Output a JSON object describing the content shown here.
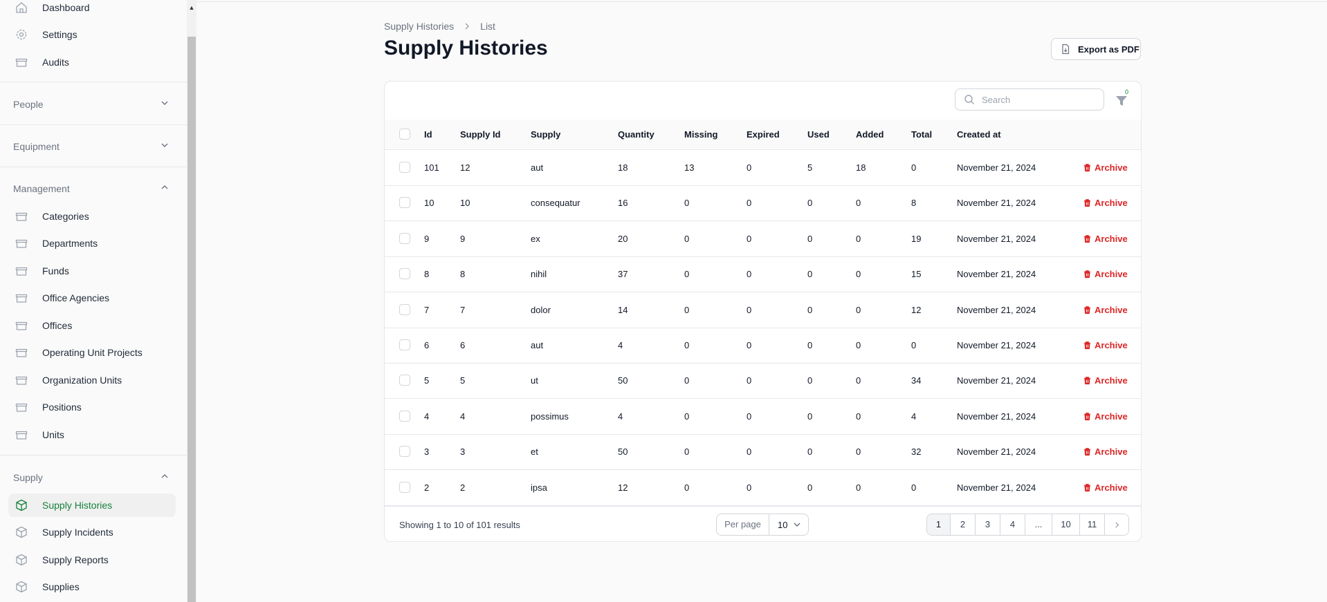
{
  "sidebar": {
    "top_items": [
      {
        "label": "Dashboard",
        "icon": "home-icon"
      },
      {
        "label": "Settings",
        "icon": "gear-icon"
      },
      {
        "label": "Audits",
        "icon": "archive-box-icon"
      }
    ],
    "groups": {
      "people": {
        "label": "People"
      },
      "equipment": {
        "label": "Equipment"
      },
      "management": {
        "label": "Management"
      },
      "supply": {
        "label": "Supply"
      }
    },
    "management_items": [
      {
        "label": "Categories"
      },
      {
        "label": "Departments"
      },
      {
        "label": "Funds"
      },
      {
        "label": "Office Agencies"
      },
      {
        "label": "Offices"
      },
      {
        "label": "Operating Unit Projects"
      },
      {
        "label": "Organization Units"
      },
      {
        "label": "Positions"
      },
      {
        "label": "Units"
      }
    ],
    "supply_items": [
      {
        "label": "Supply Histories",
        "active": true
      },
      {
        "label": "Supply Incidents"
      },
      {
        "label": "Supply Reports"
      },
      {
        "label": "Supplies"
      }
    ]
  },
  "breadcrumb": {
    "parent": "Supply Histories",
    "current": "List"
  },
  "page": {
    "title": "Supply Histories",
    "export_label": "Export as PDF"
  },
  "search": {
    "placeholder": "Search",
    "value": ""
  },
  "filter": {
    "count": "0"
  },
  "table": {
    "headers": [
      "Id",
      "Supply Id",
      "Supply",
      "Quantity",
      "Missing",
      "Expired",
      "Used",
      "Added",
      "Total",
      "Created at"
    ],
    "action_label": "Archive",
    "rows": [
      [
        "101",
        "12",
        "aut",
        "18",
        "13",
        "0",
        "5",
        "18",
        "0",
        "November 21, 2024"
      ],
      [
        "10",
        "10",
        "consequatur",
        "16",
        "0",
        "0",
        "0",
        "0",
        "8",
        "November 21, 2024"
      ],
      [
        "9",
        "9",
        "ex",
        "20",
        "0",
        "0",
        "0",
        "0",
        "19",
        "November 21, 2024"
      ],
      [
        "8",
        "8",
        "nihil",
        "37",
        "0",
        "0",
        "0",
        "0",
        "15",
        "November 21, 2024"
      ],
      [
        "7",
        "7",
        "dolor",
        "14",
        "0",
        "0",
        "0",
        "0",
        "12",
        "November 21, 2024"
      ],
      [
        "6",
        "6",
        "aut",
        "4",
        "0",
        "0",
        "0",
        "0",
        "0",
        "November 21, 2024"
      ],
      [
        "5",
        "5",
        "ut",
        "50",
        "0",
        "0",
        "0",
        "0",
        "34",
        "November 21, 2024"
      ],
      [
        "4",
        "4",
        "possimus",
        "4",
        "0",
        "0",
        "0",
        "0",
        "4",
        "November 21, 2024"
      ],
      [
        "3",
        "3",
        "et",
        "50",
        "0",
        "0",
        "0",
        "0",
        "32",
        "November 21, 2024"
      ],
      [
        "2",
        "2",
        "ipsa",
        "12",
        "0",
        "0",
        "0",
        "0",
        "0",
        "November 21, 2024"
      ]
    ]
  },
  "footer": {
    "showing": "Showing 1 to 10 of 101 results",
    "per_page_label": "Per page",
    "per_page_value": "10",
    "pages": [
      "1",
      "2",
      "3",
      "4",
      "...",
      "10",
      "11"
    ],
    "current_page": "1"
  },
  "colors": {
    "accent": "#15803d",
    "danger": "#dc2626"
  }
}
